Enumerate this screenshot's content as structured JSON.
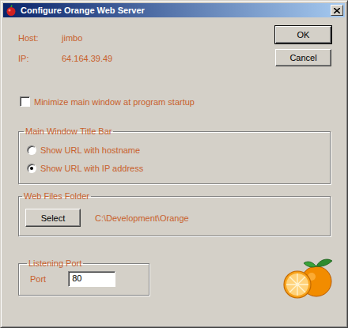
{
  "window": {
    "title": "Configure Orange Web Server"
  },
  "info": [
    {
      "label": "Host:",
      "value": "jimbo"
    },
    {
      "label": "IP:",
      "value": "64.164.39.49"
    }
  ],
  "buttons": [
    "OK",
    "Cancel"
  ],
  "minimize_checkbox": {
    "label": "Minimize main window at program startup",
    "checked": false
  },
  "title_bar_group": {
    "title": "Main Window Title Bar",
    "options": [
      {
        "label": "Show URL with hostname",
        "selected": false
      },
      {
        "label": "Show URL with IP address",
        "selected": true
      }
    ]
  },
  "web_folder_group": {
    "title": "Web Files Folder",
    "button": "Select",
    "path": "C:\\Development\\Orange"
  },
  "port_group": {
    "title": "Listening Port",
    "label": "Port",
    "value": "80"
  }
}
